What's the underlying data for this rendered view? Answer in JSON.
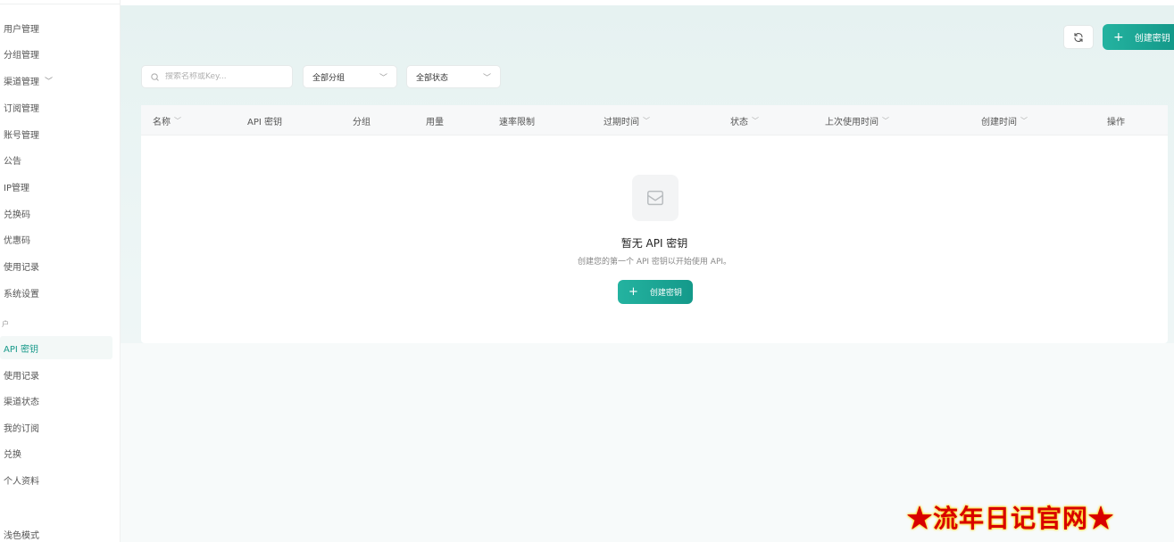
{
  "sidebar": {
    "admin_items": [
      {
        "label": "用户管理"
      },
      {
        "label": "分组管理"
      },
      {
        "label": "渠道管理",
        "expandable": true
      },
      {
        "label": "订阅管理"
      },
      {
        "label": "账号管理"
      },
      {
        "label": "公告"
      },
      {
        "label": "IP管理"
      },
      {
        "label": "兑换码"
      },
      {
        "label": "优惠码"
      },
      {
        "label": "使用记录"
      },
      {
        "label": "系统设置"
      }
    ],
    "group_label": "户",
    "user_items": [
      {
        "label": "API 密钥",
        "active": true
      },
      {
        "label": "使用记录"
      },
      {
        "label": "渠道状态"
      },
      {
        "label": "我的订阅"
      },
      {
        "label": "兑换"
      },
      {
        "label": "个人资料"
      }
    ],
    "theme_label": "浅色模式",
    "accent_color": "#17998a"
  },
  "toolbar": {
    "refresh_icon": "refresh-icon",
    "create_label": "创建密钥"
  },
  "filters": {
    "search_placeholder": "搜索名称或Key...",
    "group_select": "全部分组",
    "status_select": "全部状态"
  },
  "table": {
    "columns": [
      {
        "label": "名称",
        "sortable": true
      },
      {
        "label": "API 密钥",
        "sortable": false
      },
      {
        "label": "分组",
        "sortable": false
      },
      {
        "label": "用量",
        "sortable": false
      },
      {
        "label": "速率限制",
        "sortable": false
      },
      {
        "label": "过期时间",
        "sortable": true
      },
      {
        "label": "状态",
        "sortable": true
      },
      {
        "label": "上次使用时间",
        "sortable": true
      },
      {
        "label": "创建时间",
        "sortable": true
      },
      {
        "label": "操作",
        "sortable": false
      }
    ],
    "empty": {
      "icon": "inbox-icon",
      "title": "暂无 API 密钥",
      "description": "创建您的第一个 API 密钥以开始使用 API。",
      "button_label": "创建密钥"
    }
  },
  "watermark": "★流年日记官网★"
}
